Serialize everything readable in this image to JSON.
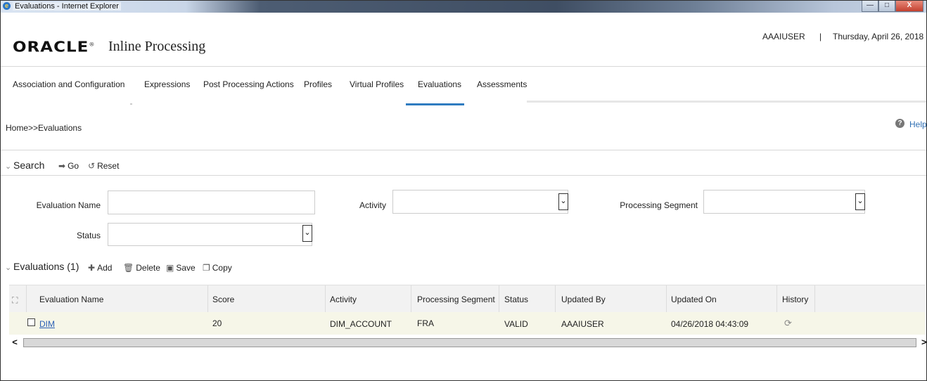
{
  "window": {
    "title": "Evaluations - Internet Explorer",
    "minimize": "—",
    "maximize": "□",
    "close": "X"
  },
  "header": {
    "logo": "ORACLE",
    "logo_mark": "®",
    "app_title": "Inline Processing",
    "user": "AAAIUSER",
    "separator": "|",
    "date": "Thursday, April 26, 2018"
  },
  "nav": {
    "tabs": [
      {
        "label": "Association and Configuration"
      },
      {
        "label": "Expressions"
      },
      {
        "label": "Post Processing Actions"
      },
      {
        "label": "Profiles"
      },
      {
        "label": "Virtual Profiles"
      },
      {
        "label": "Evaluations",
        "active": true
      },
      {
        "label": "Assessments"
      }
    ]
  },
  "breadcrumb": "Home>>Evaluations",
  "help": "Help",
  "search": {
    "title": "Search",
    "go": "Go",
    "reset": "Reset",
    "fields": {
      "evaluation_name_label": "Evaluation Name",
      "evaluation_name_value": "",
      "activity_label": "Activity",
      "activity_value": "",
      "processing_segment_label": "Processing Segment",
      "processing_segment_value": "",
      "status_label": "Status",
      "status_value": ""
    }
  },
  "evaluations": {
    "title": "Evaluations (1)",
    "add": "Add",
    "delete": "Delete",
    "save": "Save",
    "copy": "Copy",
    "columns": [
      "Evaluation Name",
      "Score",
      "Activity",
      "Processing Segment",
      "Status",
      "Updated By",
      "Updated On",
      "History"
    ],
    "rows": [
      {
        "name": "DIM",
        "score": "20",
        "activity": "DIM_ACCOUNT",
        "segment": "FRA",
        "status": "VALID",
        "updated_by": "AAAIUSER",
        "updated_on": "04/26/2018 04:43:09"
      }
    ]
  },
  "colors": {
    "accent": "#2f7cc0",
    "link": "#2b5fb5",
    "row_bg": "#f6f6e8",
    "header_bg": "#f2f2f2"
  }
}
